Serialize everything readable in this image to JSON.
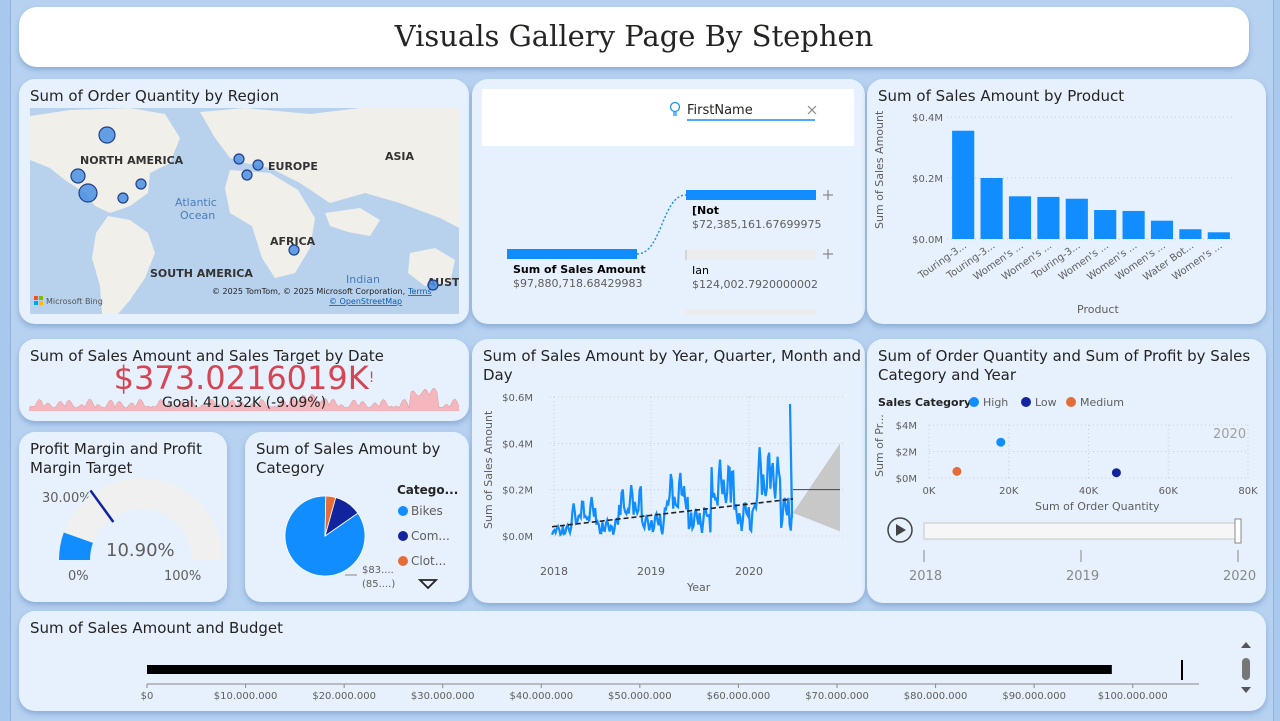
{
  "header": {
    "title": "Visuals Gallery Page By Stephen"
  },
  "map": {
    "title": "Sum of Order Quantity by Region",
    "labels": {
      "north_america": "NORTH AMERICA",
      "europe": "EUROPE",
      "asia": "ASIA",
      "atlantic_ocean_1": "Atlantic",
      "atlantic_ocean_2": "Ocean",
      "africa": "AFRICA",
      "south_america": "SOUTH AMERICA",
      "indian_ocean": "Indian",
      "australia": "AUSTI"
    },
    "attribution": "© 2025 TomTom, © 2025 Microsoft Corporation,",
    "terms": "Terms",
    "osm": "© OpenStreetMap",
    "logo": "Microsoft Bing"
  },
  "decomp": {
    "search_value": "FirstName",
    "root": {
      "label": "Sum of Sales Amount",
      "value": "$97,880,718.68429983"
    },
    "nodes": [
      {
        "label": "[Not",
        "value": "$72,385,161.67699975"
      },
      {
        "label": "Ian",
        "value": "$124,002.7920000002"
      }
    ]
  },
  "product": {
    "title": "Sum of Sales Amount by Product",
    "ylabel": "Sum of Sales Amount",
    "xlabel": "Product"
  },
  "kpi": {
    "title": "Sum of Sales Amount and Sales Target by Date",
    "value": "$373.0216019K",
    "alert": "!",
    "goal": "Goal: 410.32K (-9.09%)"
  },
  "gauge": {
    "title_1": "Profit Margin and Profit",
    "title_2": "Margin Target",
    "target_label": "30.00%",
    "value_label": "10.90%",
    "min_label": "0%",
    "max_label": "100%",
    "value": 0.109,
    "target": 0.3
  },
  "category": {
    "title_1": "Sum of Sales Amount by",
    "title_2": "Category",
    "legend_title": "Catego...",
    "legend": [
      {
        "name": "Bikes",
        "color": "#118dff"
      },
      {
        "name": "Com...",
        "color": "#12239e"
      },
      {
        "name": "Clot...",
        "color": "#e66c37"
      }
    ],
    "slice_label_1": "$83....",
    "slice_label_2": "(85....)"
  },
  "trend": {
    "title_1": "Sum of Sales Amount by Year, Quarter, Month and",
    "title_2": "Day",
    "ylabel": "Sum of Sales Amount",
    "xlabel": "Year"
  },
  "scatter": {
    "title_1": "Sum of Order Quantity and Sum of Profit by Sales",
    "title_2": "Category and Year",
    "legend_title": "Sales Category",
    "legend": [
      {
        "name": "High",
        "color": "#118dff"
      },
      {
        "name": "Low",
        "color": "#12239e"
      },
      {
        "name": "Medium",
        "color": "#e66c37"
      }
    ],
    "ylabel": "Sum of Pr...",
    "xlabel": "Sum of Order Quantity",
    "year_watermark": "2020",
    "play_ticks": [
      "2018",
      "2019",
      "2020"
    ]
  },
  "budget": {
    "title": "Sum of Sales Amount and Budget"
  },
  "chart_data": [
    {
      "type": "bar",
      "title": "Sum of Sales Amount by Product",
      "categories": [
        "Touring-3...",
        "Touring-3...",
        "Women's ...",
        "Women's ...",
        "Touring-3...",
        "Women's ...",
        "Women's ...",
        "Women's ...",
        "Water Bot...",
        "Women's ..."
      ],
      "values": [
        0.355,
        0.2,
        0.14,
        0.138,
        0.132,
        0.095,
        0.092,
        0.06,
        0.032,
        0.022
      ],
      "unit": "$M",
      "yticks": [
        "$0.0M",
        "$0.2M",
        "$0.4M"
      ],
      "ylim": [
        0,
        0.4
      ],
      "xlabel": "Product",
      "ylabel": "Sum of Sales Amount",
      "color": "#118dff"
    },
    {
      "type": "pie",
      "title": "Sum of Sales Amount by Category",
      "categories": [
        "Bikes",
        "Com...",
        "Clot..."
      ],
      "values": [
        85,
        11,
        4
      ]
    },
    {
      "type": "line",
      "title": "Sum of Sales Amount by Year, Quarter, Month and Day",
      "xticks": [
        "2018",
        "2019",
        "2020"
      ],
      "yticks": [
        "$0.0M",
        "$0.2M",
        "$0.4M",
        "$0.6M"
      ],
      "ylim": [
        0,
        0.6
      ],
      "xlabel": "Year",
      "ylabel": "Sum of Sales Amount",
      "trend_start": 0.04,
      "trend_end": 0.16,
      "color": "#118dff"
    },
    {
      "type": "scatter",
      "title": "Sum of Order Quantity and Sum of Profit by Sales Category and Year",
      "xticks": [
        "0K",
        "20K",
        "40K",
        "60K",
        "80K"
      ],
      "yticks": [
        "$0M",
        "$2M",
        "$4M"
      ],
      "xlim": [
        0,
        80000
      ],
      "ylim": [
        0,
        4
      ],
      "points": [
        {
          "series": "High",
          "x": 18000,
          "y": 2.7
        },
        {
          "series": "Low",
          "x": 47000,
          "y": 0.4
        },
        {
          "series": "Medium",
          "x": 7000,
          "y": 0.5
        }
      ]
    },
    {
      "type": "bar",
      "title": "Sum of Sales Amount and Budget",
      "orientation": "horizontal",
      "value": 97880718.68,
      "target": 105000000,
      "xticks": [
        "$0",
        "$10.000.000",
        "$20.000.000",
        "$30.000.000",
        "$40.000.000",
        "$50.000.000",
        "$60.000.000",
        "$70.000.000",
        "$80.000.000",
        "$90.000.000",
        "$100.000.000"
      ],
      "xlim": [
        0,
        105000000
      ]
    }
  ]
}
